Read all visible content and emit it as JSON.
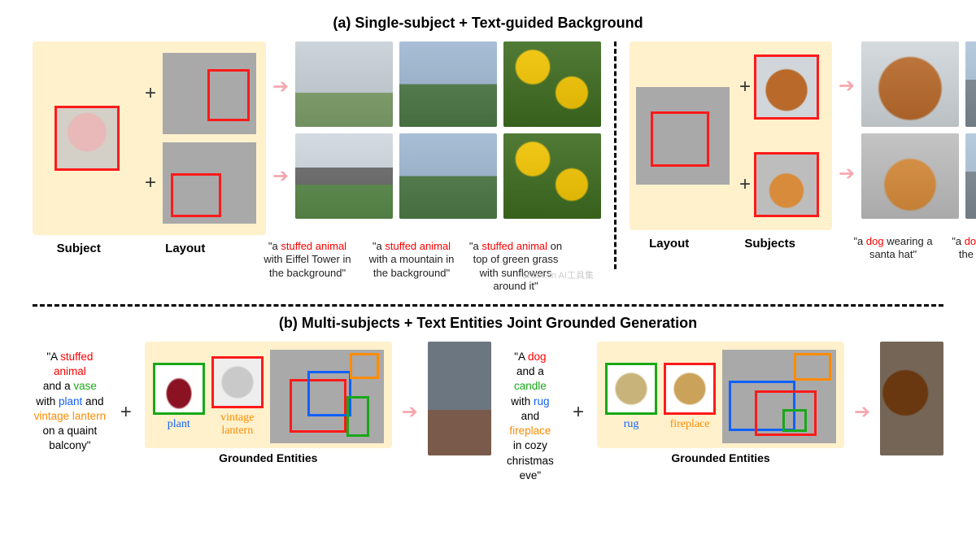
{
  "section_a": {
    "title": "(a) Single-subject + Text-guided Background",
    "labels": {
      "subject": "Subject",
      "layout": "Layout",
      "subjects": "Subjects"
    },
    "captions_left": [
      {
        "pre": "\"a ",
        "hl": "stuffed animal",
        "post": " with Eiffel Tower in the background\""
      },
      {
        "pre": "\"a ",
        "hl": "stuffed animal",
        "post": " with a mountain in the background\""
      },
      {
        "pre": "\"a ",
        "hl": "stuffed animal",
        "post": " on top of green grass with sunflowers around it\""
      }
    ],
    "captions_right": [
      {
        "pre": "\"a ",
        "hl": "dog",
        "post": " wearing a santa hat\""
      },
      {
        "pre": "\"a ",
        "hl": "dog",
        "post": " with a city in the background\""
      }
    ]
  },
  "section_b": {
    "title": "(b) Multi-subjects + Text Entities Joint Grounded Generation",
    "grounded_label": "Grounded Entities",
    "left": {
      "prompt": {
        "p1": "\"A ",
        "hl1": "stuffed animal",
        "p2": " and a ",
        "hl2": "vase",
        "p3": " with ",
        "hl3": "plant",
        "p4": " and ",
        "hl4": "vintage lantern",
        "p5": " on a quaint balcony\""
      },
      "ent1": "plant",
      "ent2": "vintage lantern"
    },
    "right": {
      "prompt": {
        "p1": "\"A ",
        "hl1": "dog",
        "p2": " and a ",
        "hl2": "candle",
        "p3": " with ",
        "hl3": "rug",
        "p4": " and ",
        "hl4": "fireplace",
        "p5": " in cozy christmas eve\""
      },
      "ent1": "rug",
      "ent2": "fireplace"
    }
  },
  "watermark": "ai-bot.cn  AI工具集"
}
